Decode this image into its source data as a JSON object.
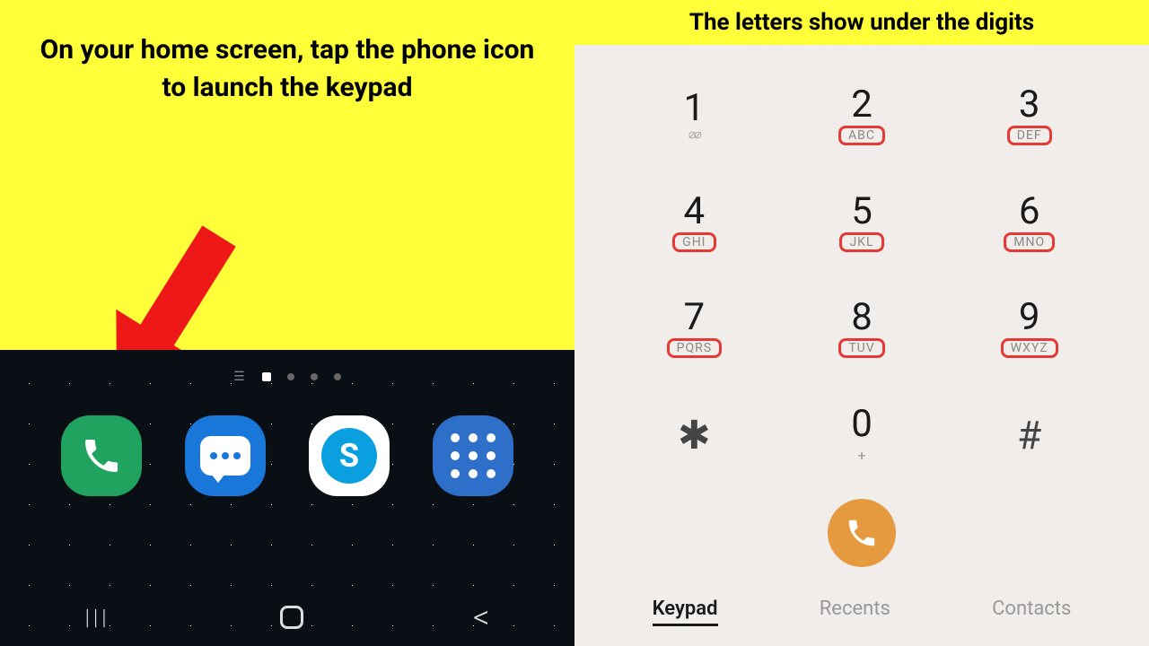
{
  "left_instruction": "On your home screen, tap the phone icon to launch the keypad",
  "right_title": "The letters show under the digits",
  "dock_apps": {
    "phone": "phone",
    "messages": "messages",
    "skype": "S",
    "apps": "apps"
  },
  "keypad": [
    {
      "digit": "1",
      "letters": "",
      "voicemail": true,
      "highlight": false
    },
    {
      "digit": "2",
      "letters": "ABC",
      "highlight": true
    },
    {
      "digit": "3",
      "letters": "DEF",
      "highlight": true
    },
    {
      "digit": "4",
      "letters": "GHI",
      "highlight": true
    },
    {
      "digit": "5",
      "letters": "JKL",
      "highlight": true
    },
    {
      "digit": "6",
      "letters": "MNO",
      "highlight": true
    },
    {
      "digit": "7",
      "letters": "PQRS",
      "highlight": true
    },
    {
      "digit": "8",
      "letters": "TUV",
      "highlight": true
    },
    {
      "digit": "9",
      "letters": "WXYZ",
      "highlight": true
    },
    {
      "digit": "✱",
      "letters": "",
      "symbol": true
    },
    {
      "digit": "0",
      "letters": "",
      "plus": "+"
    },
    {
      "digit": "#",
      "letters": "",
      "symbol": true
    }
  ],
  "tabs": {
    "keypad": "Keypad",
    "recents": "Recents",
    "contacts": "Contacts"
  }
}
